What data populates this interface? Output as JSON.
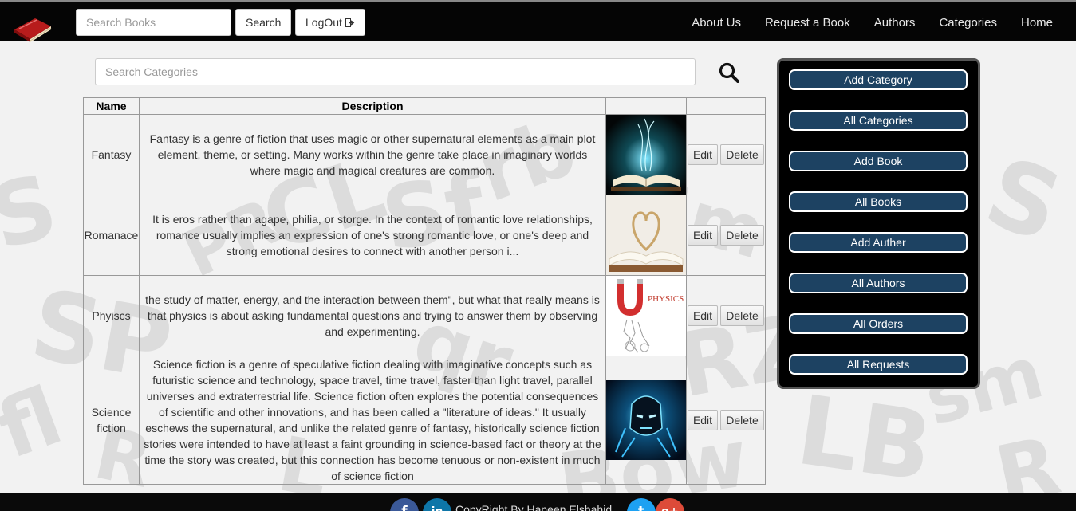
{
  "navbar": {
    "search_placeholder": "Search Books",
    "search_button": "Search",
    "logout_button": "LogOut",
    "links": [
      "About Us",
      "Request a Book",
      "Authors",
      "Categories",
      "Home"
    ]
  },
  "category_search": {
    "placeholder": "Search Categories"
  },
  "table": {
    "headers": [
      "Name",
      "Description",
      "",
      "",
      ""
    ],
    "rows": [
      {
        "name": "Fantasy",
        "description": "Fantasy is a genre of fiction that uses magic or other supernatural elements as a main plot element, theme, or setting. Many works within the genre take place in imaginary worlds where magic and magical creatures are common.",
        "edit": "Edit",
        "delete": "Delete"
      },
      {
        "name": "Romanace",
        "description": "It is eros rather than agape, philia, or storge. In the context of romantic love relationships, romance usually implies an expression of one's strong romantic love, or one's deep and strong emotional desires to connect with another person i...",
        "edit": "Edit",
        "delete": "Delete"
      },
      {
        "name": "Phyiscs",
        "description": "the study of matter, energy, and the interaction between them\", but what that really means is that physics is about asking fundamental questions and trying to answer them by observing and experimenting.",
        "image_text": "PHYSICS",
        "edit": "Edit",
        "delete": "Delete"
      },
      {
        "name": "Science fiction",
        "description": "Science fiction is a genre of speculative fiction dealing with imaginative concepts such as futuristic science and technology, space travel, time travel, faster than light travel, parallel universes and extraterrestrial life. Science fiction often explores the potential consequences of scientific and other innovations, and has been called a \"literature of ideas.\" It usually eschews the supernatural, and unlike the related genre of fantasy, historically science fiction stories were intended to have at least a faint grounding in science-based fact or theory at the time the story was created, but this connection has become tenuous or non-existent in much of science fiction",
        "edit": "Edit",
        "delete": "Delete"
      }
    ]
  },
  "side_panel": {
    "buttons": [
      "Add Category",
      "All Categories",
      "Add Book",
      "All Books",
      "Add Auther",
      "All Authors",
      "All Orders",
      "All Requests"
    ]
  },
  "footer": {
    "copyright": "CopyRight By Haneen Elshahid",
    "social": [
      "f",
      "in",
      "t",
      "g+"
    ]
  },
  "colors": {
    "navbar": "#050505",
    "panel_button": "#1d4262",
    "facebook": "#3b5998",
    "linkedin": "#0e76a8",
    "twitter": "#1da1f2",
    "google": "#dd4b39"
  }
}
